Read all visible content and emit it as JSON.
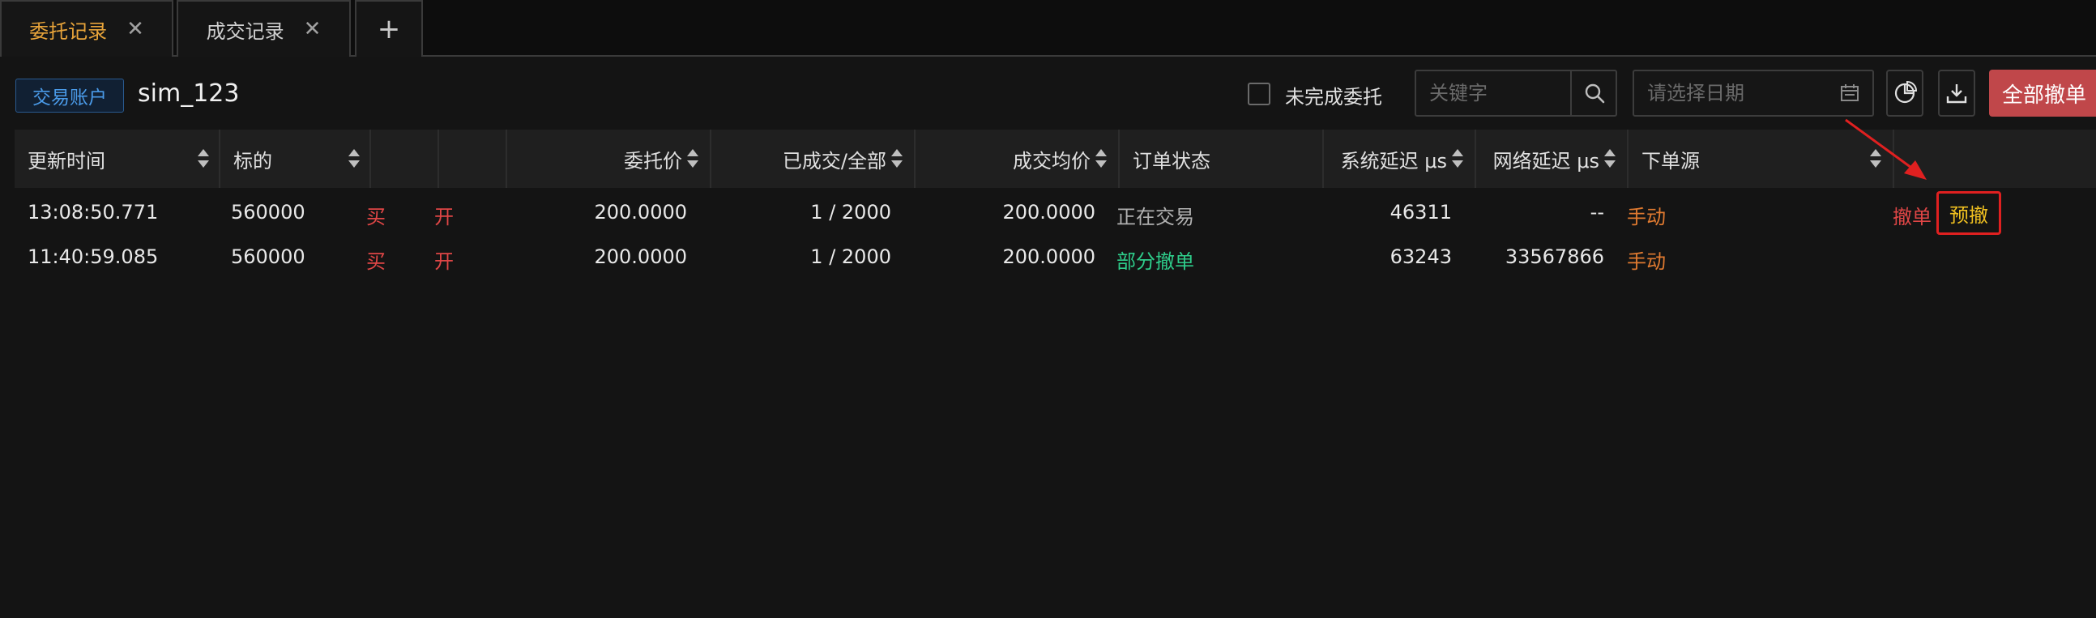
{
  "tabs": [
    {
      "label": "委托记录",
      "active": true
    },
    {
      "label": "成交记录",
      "active": false
    }
  ],
  "tab_close_glyph": "✕",
  "tab_add_glyph": "+",
  "toolbar": {
    "account_badge": "交易账户",
    "account_name": "sim_123",
    "unfinished_label": "未完成委托",
    "unfinished_checked": false,
    "search_placeholder": "关键字",
    "date_placeholder": "请选择日期",
    "cancel_all_label": "全部撤单"
  },
  "table": {
    "headers": {
      "time": "更新时间",
      "symbol": "标的",
      "price": "委托价",
      "filled": "已成交/全部",
      "avg": "成交均价",
      "status": "订单状态",
      "sys_latency": "系统延迟 μs",
      "net_latency": "网络延迟 μs",
      "source": "下单源"
    },
    "rows": [
      {
        "time": "13:08:50.771",
        "symbol": "560000",
        "side": "买",
        "offset": "开",
        "price": "200.0000",
        "filled": "1 / 2000",
        "avg": "200.0000",
        "status": "正在交易",
        "sys_latency": "46311",
        "net_latency": "--",
        "source": "手动",
        "action_cancel": "撤单",
        "action_precancel": "预撤"
      },
      {
        "time": "11:40:59.085",
        "symbol": "560000",
        "side": "买",
        "offset": "开",
        "price": "200.0000",
        "filled": "1 / 2000",
        "avg": "200.0000",
        "status": "部分撤单",
        "sys_latency": "63243",
        "net_latency": "33567866",
        "source": "手动"
      }
    ]
  },
  "colors": {
    "active_tab": "#e8a43a",
    "buy_red": "#e04646",
    "source_orange": "#e07a30",
    "partial_cancel_green": "#2ecc8a",
    "cancel_all_bg": "#c0474a",
    "annotation_red": "#e02020"
  },
  "icons": {
    "search": "search-icon",
    "calendar": "calendar-icon",
    "chart": "pie-chart-icon",
    "download": "download-icon"
  }
}
